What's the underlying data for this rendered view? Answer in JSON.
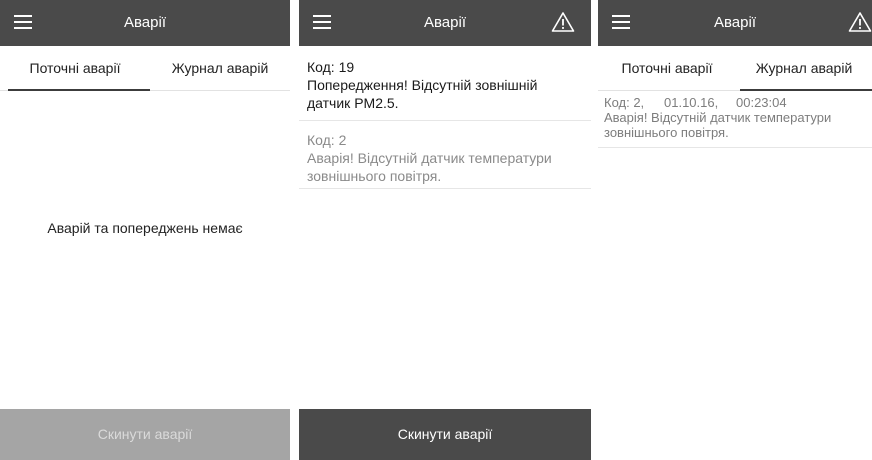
{
  "screen1": {
    "title": "Аварії",
    "tabs": [
      "Поточні аварії",
      "Журнал аварій"
    ],
    "empty_message": "Аварій та попереджень немає",
    "reset_button": "Скинути аварії"
  },
  "screen2": {
    "title": "Аварії",
    "alarms": [
      {
        "code": "Код: 19",
        "text": "Попередження! Відсутній зовнішній датчик PM2.5."
      },
      {
        "code": "Код: 2",
        "text": "Аварія! Відсутній датчик температури зовнішнього повітря."
      }
    ],
    "reset_button": "Скинути аварії"
  },
  "screen3": {
    "title": "Аварії",
    "tabs": [
      "Поточні аварії",
      "Журнал аварій"
    ],
    "log": [
      {
        "code": "Код: 2,",
        "date": "01.10.16,",
        "time": "00:23:04",
        "text": "Аварія! Відсутній датчик температури зовнішнього повітря."
      }
    ]
  },
  "colors": {
    "appbar": "#4a4a4a",
    "button_disabled": "#a5a5a5",
    "button_active": "#4a4a4a"
  },
  "icons": [
    "menu-icon",
    "warning-icon"
  ]
}
